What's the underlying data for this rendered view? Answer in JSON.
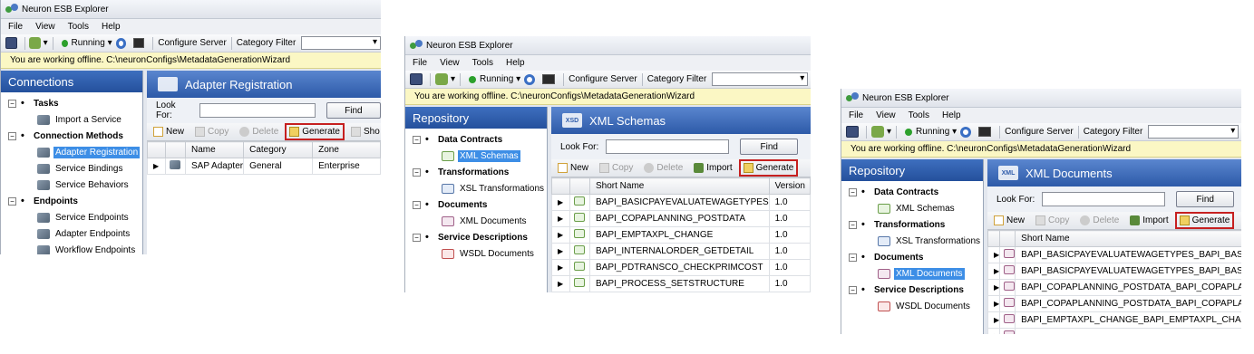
{
  "app_title": "Neuron ESB Explorer",
  "menu": [
    "File",
    "View",
    "Tools",
    "Help"
  ],
  "toolbar": {
    "running": "Running",
    "configure_server": "Configure Server",
    "category_filter": "Category Filter"
  },
  "offline_message": "You are working offline. C:\\neuronConfigs\\MetadataGenerationWizard",
  "lookfor_label": "Look For:",
  "find_label": "Find",
  "win1": {
    "panel_title": "Connections",
    "right_title": "Adapter Registration",
    "groups": [
      {
        "label": "Tasks",
        "items": [
          "Import a Service"
        ]
      },
      {
        "label": "Connection Methods",
        "items": [
          "Adapter Registration",
          "Service Bindings",
          "Service Behaviors"
        ]
      },
      {
        "label": "Endpoints",
        "items": [
          "Service Endpoints",
          "Adapter Endpoints",
          "Workflow Endpoints"
        ]
      }
    ],
    "actions": [
      "New",
      "Copy",
      "Delete",
      "Generate",
      "Sho"
    ],
    "columns": [
      "Name",
      "Category",
      "Zone"
    ],
    "rows": [
      {
        "name": "SAP Adapter",
        "category": "General",
        "zone": "Enterprise"
      }
    ]
  },
  "win2": {
    "panel_title": "Repository",
    "right_title": "XML Schemas",
    "groups": [
      {
        "label": "Data Contracts",
        "items": [
          "XML Schemas"
        ]
      },
      {
        "label": "Transformations",
        "items": [
          "XSL Transformations"
        ]
      },
      {
        "label": "Documents",
        "items": [
          "XML Documents"
        ]
      },
      {
        "label": "Service Descriptions",
        "items": [
          "WSDL Documents"
        ]
      }
    ],
    "actions": [
      "New",
      "Copy",
      "Delete",
      "Import",
      "Generate"
    ],
    "columns": [
      "Short Name",
      "Version"
    ],
    "rows": [
      {
        "name": "BAPI_BASICPAYEVALUATEWAGETYPES",
        "version": "1.0"
      },
      {
        "name": "BAPI_COPAPLANNING_POSTDATA",
        "version": "1.0"
      },
      {
        "name": "BAPI_EMPTAXPL_CHANGE",
        "version": "1.0"
      },
      {
        "name": "BAPI_INTERNALORDER_GETDETAIL",
        "version": "1.0"
      },
      {
        "name": "BAPI_PDTRANSCO_CHECKPRIMCOST",
        "version": "1.0"
      },
      {
        "name": "BAPI_PROCESS_SETSTRUCTURE",
        "version": "1.0"
      }
    ]
  },
  "win3": {
    "panel_title": "Repository",
    "right_title": "XML Documents",
    "groups": [
      {
        "label": "Data Contracts",
        "items": [
          "XML Schemas"
        ]
      },
      {
        "label": "Transformations",
        "items": [
          "XSL Transformations"
        ]
      },
      {
        "label": "Documents",
        "items": [
          "XML Documents"
        ]
      },
      {
        "label": "Service Descriptions",
        "items": [
          "WSDL Documents"
        ]
      }
    ],
    "actions": [
      "New",
      "Copy",
      "Delete",
      "Import",
      "Generate"
    ],
    "columns": [
      "Short Name"
    ],
    "rows": [
      "BAPI_BASICPAYEVALUATEWAGETYPES_BAPI_BASIC",
      "BAPI_BASICPAYEVALUATEWAGETYPES_BAPI_BASIC",
      "BAPI_COPAPLANNING_POSTDATA_BAPI_COPAPLAN",
      "BAPI_COPAPLANNING_POSTDATA_BAPI_COPAPLAN",
      "BAPI_EMPTAXPL_CHANGE_BAPI_EMPTAXPL_CHANG",
      ""
    ]
  }
}
